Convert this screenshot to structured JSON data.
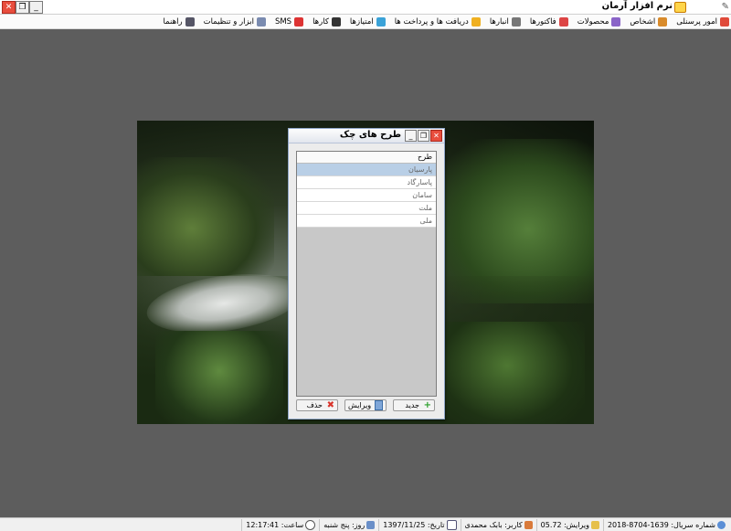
{
  "window": {
    "title": "نرم افزار آرمان",
    "close_glyph": "✕",
    "restore_glyph": "❐",
    "minimize_glyph": "_"
  },
  "menu": {
    "items": [
      {
        "label": "امور پرسنلی",
        "icon": "people-icon",
        "color": "#e04a3a"
      },
      {
        "label": "اشخاص",
        "icon": "person-icon",
        "color": "#d98b2b"
      },
      {
        "label": "محصولات",
        "icon": "box-icon",
        "color": "#8a64c8"
      },
      {
        "label": "فاکتورها",
        "icon": "invoice-icon",
        "color": "#d44"
      },
      {
        "label": "انبارها",
        "icon": "warehouse-icon",
        "color": "#777"
      },
      {
        "label": "دریافت ها و پرداخت ها",
        "icon": "star-icon",
        "color": "#f0b020"
      },
      {
        "label": "امتیازها",
        "icon": "score-icon",
        "color": "#3aa2d8"
      },
      {
        "label": "کارها",
        "icon": "chat-icon",
        "color": "#333"
      },
      {
        "label": "SMS",
        "icon": "sms-icon",
        "color": "#d33"
      },
      {
        "label": "ابزار و تنظیمات",
        "icon": "tools-icon",
        "color": "#7a8bb0"
      },
      {
        "label": "راهنما",
        "icon": "help-icon",
        "color": "#556"
      }
    ]
  },
  "dialog": {
    "title": "طرح های چک",
    "column_header": "طرح",
    "rows": [
      "پارسیان",
      "پاسارگاد",
      "سامان",
      "ملت",
      "ملی"
    ],
    "selected_index": 0,
    "new_label": "جدید",
    "edit_label": "ویرایش",
    "delete_label": "حذف"
  },
  "status": {
    "serial": "شماره سریال: 1639-8704-2018",
    "version": "ویرایش: 05.72",
    "user": "کاربر: بابک محمدی",
    "date": "تاریخ: 1397/11/25",
    "day": "روز: پنج شنبه",
    "time": "ساعت: 12:17:41"
  }
}
